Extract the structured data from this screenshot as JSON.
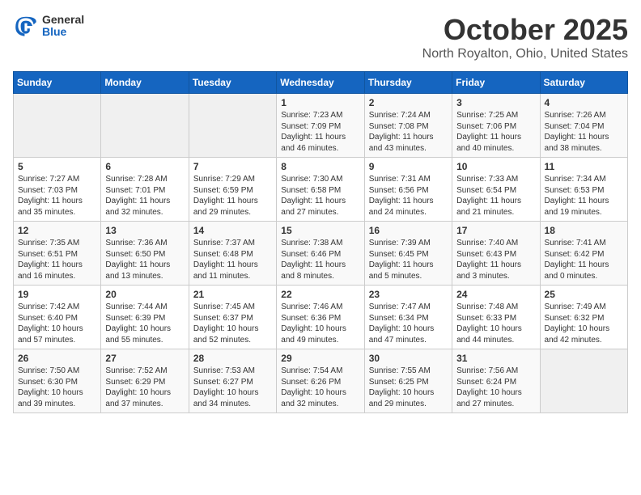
{
  "logo": {
    "general": "General",
    "blue": "Blue"
  },
  "title": {
    "month": "October 2025",
    "location": "North Royalton, Ohio, United States"
  },
  "weekdays": [
    "Sunday",
    "Monday",
    "Tuesday",
    "Wednesday",
    "Thursday",
    "Friday",
    "Saturday"
  ],
  "weeks": [
    [
      {
        "day": "",
        "sunrise": "",
        "sunset": "",
        "daylight": ""
      },
      {
        "day": "",
        "sunrise": "",
        "sunset": "",
        "daylight": ""
      },
      {
        "day": "",
        "sunrise": "",
        "sunset": "",
        "daylight": ""
      },
      {
        "day": "1",
        "sunrise": "Sunrise: 7:23 AM",
        "sunset": "Sunset: 7:09 PM",
        "daylight": "Daylight: 11 hours and 46 minutes."
      },
      {
        "day": "2",
        "sunrise": "Sunrise: 7:24 AM",
        "sunset": "Sunset: 7:08 PM",
        "daylight": "Daylight: 11 hours and 43 minutes."
      },
      {
        "day": "3",
        "sunrise": "Sunrise: 7:25 AM",
        "sunset": "Sunset: 7:06 PM",
        "daylight": "Daylight: 11 hours and 40 minutes."
      },
      {
        "day": "4",
        "sunrise": "Sunrise: 7:26 AM",
        "sunset": "Sunset: 7:04 PM",
        "daylight": "Daylight: 11 hours and 38 minutes."
      }
    ],
    [
      {
        "day": "5",
        "sunrise": "Sunrise: 7:27 AM",
        "sunset": "Sunset: 7:03 PM",
        "daylight": "Daylight: 11 hours and 35 minutes."
      },
      {
        "day": "6",
        "sunrise": "Sunrise: 7:28 AM",
        "sunset": "Sunset: 7:01 PM",
        "daylight": "Daylight: 11 hours and 32 minutes."
      },
      {
        "day": "7",
        "sunrise": "Sunrise: 7:29 AM",
        "sunset": "Sunset: 6:59 PM",
        "daylight": "Daylight: 11 hours and 29 minutes."
      },
      {
        "day": "8",
        "sunrise": "Sunrise: 7:30 AM",
        "sunset": "Sunset: 6:58 PM",
        "daylight": "Daylight: 11 hours and 27 minutes."
      },
      {
        "day": "9",
        "sunrise": "Sunrise: 7:31 AM",
        "sunset": "Sunset: 6:56 PM",
        "daylight": "Daylight: 11 hours and 24 minutes."
      },
      {
        "day": "10",
        "sunrise": "Sunrise: 7:33 AM",
        "sunset": "Sunset: 6:54 PM",
        "daylight": "Daylight: 11 hours and 21 minutes."
      },
      {
        "day": "11",
        "sunrise": "Sunrise: 7:34 AM",
        "sunset": "Sunset: 6:53 PM",
        "daylight": "Daylight: 11 hours and 19 minutes."
      }
    ],
    [
      {
        "day": "12",
        "sunrise": "Sunrise: 7:35 AM",
        "sunset": "Sunset: 6:51 PM",
        "daylight": "Daylight: 11 hours and 16 minutes."
      },
      {
        "day": "13",
        "sunrise": "Sunrise: 7:36 AM",
        "sunset": "Sunset: 6:50 PM",
        "daylight": "Daylight: 11 hours and 13 minutes."
      },
      {
        "day": "14",
        "sunrise": "Sunrise: 7:37 AM",
        "sunset": "Sunset: 6:48 PM",
        "daylight": "Daylight: 11 hours and 11 minutes."
      },
      {
        "day": "15",
        "sunrise": "Sunrise: 7:38 AM",
        "sunset": "Sunset: 6:46 PM",
        "daylight": "Daylight: 11 hours and 8 minutes."
      },
      {
        "day": "16",
        "sunrise": "Sunrise: 7:39 AM",
        "sunset": "Sunset: 6:45 PM",
        "daylight": "Daylight: 11 hours and 5 minutes."
      },
      {
        "day": "17",
        "sunrise": "Sunrise: 7:40 AM",
        "sunset": "Sunset: 6:43 PM",
        "daylight": "Daylight: 11 hours and 3 minutes."
      },
      {
        "day": "18",
        "sunrise": "Sunrise: 7:41 AM",
        "sunset": "Sunset: 6:42 PM",
        "daylight": "Daylight: 11 hours and 0 minutes."
      }
    ],
    [
      {
        "day": "19",
        "sunrise": "Sunrise: 7:42 AM",
        "sunset": "Sunset: 6:40 PM",
        "daylight": "Daylight: 10 hours and 57 minutes."
      },
      {
        "day": "20",
        "sunrise": "Sunrise: 7:44 AM",
        "sunset": "Sunset: 6:39 PM",
        "daylight": "Daylight: 10 hours and 55 minutes."
      },
      {
        "day": "21",
        "sunrise": "Sunrise: 7:45 AM",
        "sunset": "Sunset: 6:37 PM",
        "daylight": "Daylight: 10 hours and 52 minutes."
      },
      {
        "day": "22",
        "sunrise": "Sunrise: 7:46 AM",
        "sunset": "Sunset: 6:36 PM",
        "daylight": "Daylight: 10 hours and 49 minutes."
      },
      {
        "day": "23",
        "sunrise": "Sunrise: 7:47 AM",
        "sunset": "Sunset: 6:34 PM",
        "daylight": "Daylight: 10 hours and 47 minutes."
      },
      {
        "day": "24",
        "sunrise": "Sunrise: 7:48 AM",
        "sunset": "Sunset: 6:33 PM",
        "daylight": "Daylight: 10 hours and 44 minutes."
      },
      {
        "day": "25",
        "sunrise": "Sunrise: 7:49 AM",
        "sunset": "Sunset: 6:32 PM",
        "daylight": "Daylight: 10 hours and 42 minutes."
      }
    ],
    [
      {
        "day": "26",
        "sunrise": "Sunrise: 7:50 AM",
        "sunset": "Sunset: 6:30 PM",
        "daylight": "Daylight: 10 hours and 39 minutes."
      },
      {
        "day": "27",
        "sunrise": "Sunrise: 7:52 AM",
        "sunset": "Sunset: 6:29 PM",
        "daylight": "Daylight: 10 hours and 37 minutes."
      },
      {
        "day": "28",
        "sunrise": "Sunrise: 7:53 AM",
        "sunset": "Sunset: 6:27 PM",
        "daylight": "Daylight: 10 hours and 34 minutes."
      },
      {
        "day": "29",
        "sunrise": "Sunrise: 7:54 AM",
        "sunset": "Sunset: 6:26 PM",
        "daylight": "Daylight: 10 hours and 32 minutes."
      },
      {
        "day": "30",
        "sunrise": "Sunrise: 7:55 AM",
        "sunset": "Sunset: 6:25 PM",
        "daylight": "Daylight: 10 hours and 29 minutes."
      },
      {
        "day": "31",
        "sunrise": "Sunrise: 7:56 AM",
        "sunset": "Sunset: 6:24 PM",
        "daylight": "Daylight: 10 hours and 27 minutes."
      },
      {
        "day": "",
        "sunrise": "",
        "sunset": "",
        "daylight": ""
      }
    ]
  ]
}
